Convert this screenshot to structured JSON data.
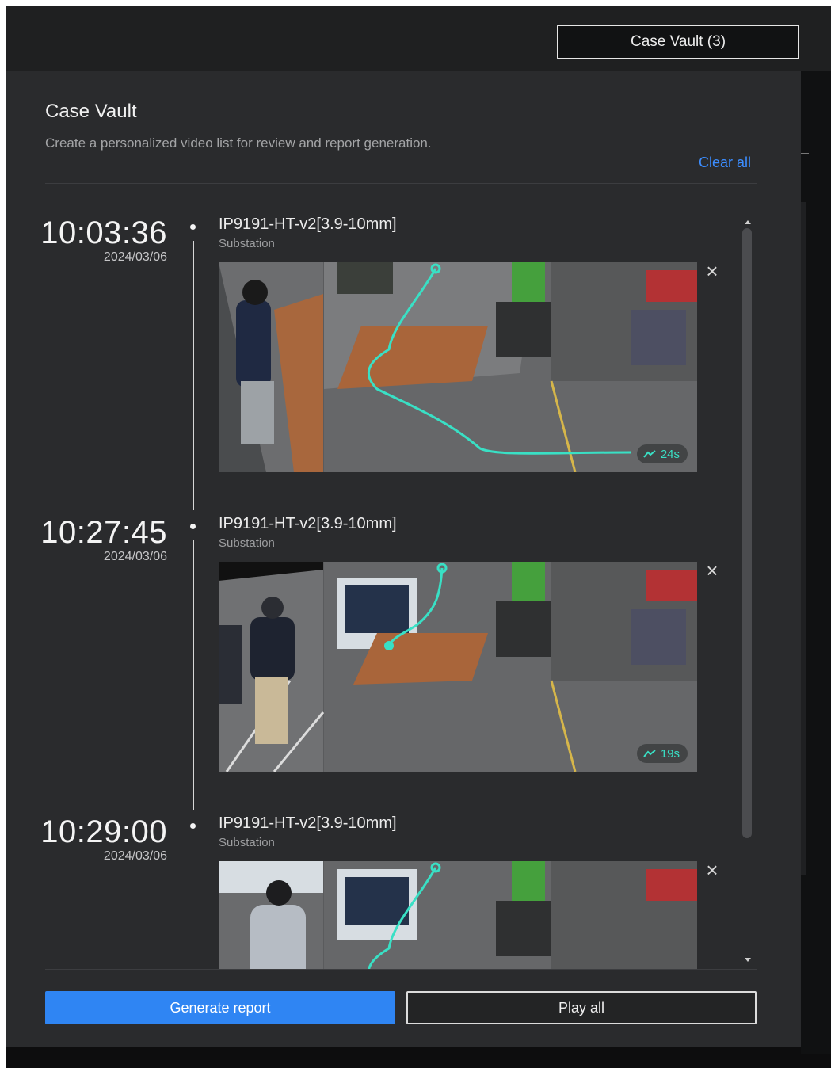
{
  "header": {
    "case_vault_button": "Case Vault (3)"
  },
  "panel": {
    "title": "Case Vault",
    "description": "Create a personalized video list for review and report generation.",
    "clear_all": "Clear all"
  },
  "entries": [
    {
      "time": "10:03:36",
      "date": "2024/03/06",
      "camera": "IP9191-HT-v2[3.9-10mm]",
      "location": "Substation",
      "duration": "24s"
    },
    {
      "time": "10:27:45",
      "date": "2024/03/06",
      "camera": "IP9191-HT-v2[3.9-10mm]",
      "location": "Substation",
      "duration": "19s"
    },
    {
      "time": "10:29:00",
      "date": "2024/03/06",
      "camera": "IP9191-HT-v2[3.9-10mm]",
      "location": "Substation",
      "duration": ""
    }
  ],
  "footer": {
    "generate_report": "Generate report",
    "play_all": "Play all"
  },
  "icons": {
    "close": "close-icon",
    "trajectory": "trajectory-icon",
    "scroll_up": "scroll-up-arrow-icon",
    "scroll_down": "scroll-down-arrow-icon"
  },
  "colors": {
    "accent": "#2f85f3",
    "link": "#3c8dff",
    "trajectory": "#39e0c5",
    "panel_bg": "#2a2b2d"
  }
}
